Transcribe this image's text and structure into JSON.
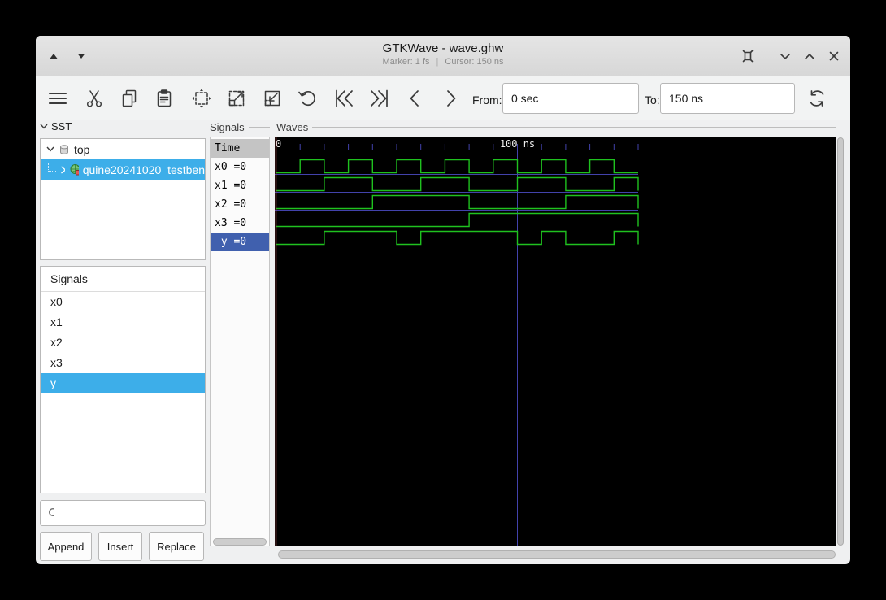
{
  "titlebar": {
    "title": "GTKWave - wave.ghw",
    "marker_status": "Marker: 1 fs",
    "separator": "|",
    "cursor_status": "Cursor: 150 ns"
  },
  "toolbar": {
    "from_label": "From:",
    "from_value": "0 sec",
    "to_label": "To:",
    "to_value": "150 ns"
  },
  "sst": {
    "header": "SST",
    "items": [
      {
        "label": "top",
        "expanded": true
      },
      {
        "label": "quine20241020_testben",
        "selected": true
      }
    ]
  },
  "signal_browser": {
    "header": "Signals",
    "items": [
      "x0",
      "x1",
      "x2",
      "x3",
      "y"
    ],
    "selected": "y",
    "search_placeholder": "",
    "buttons": {
      "append": "Append",
      "insert": "Insert",
      "replace": "Replace"
    }
  },
  "signal_values": {
    "frame_label": "Signals",
    "rows": [
      {
        "text": "Time",
        "header": true
      },
      {
        "text": "x0 =0"
      },
      {
        "text": "x1 =0"
      },
      {
        "text": "x2 =0"
      },
      {
        "text": "x3 =0"
      },
      {
        "text": " y =0",
        "selected": true
      }
    ]
  },
  "waves": {
    "frame_label": "Waves",
    "chart_data": {
      "type": "digital-waveform",
      "time_unit": "ns",
      "t_start": 0,
      "t_end": 150,
      "step": 10,
      "minor_tick_every": 10,
      "major_line_at": 100,
      "timeline_labels": [
        {
          "t": 0,
          "text": "0"
        },
        {
          "t": 100,
          "text": "100 ns"
        }
      ],
      "marker_time": "1 fs",
      "cursor_time": "150 ns",
      "signals": [
        {
          "name": "x0",
          "values": [
            0,
            1,
            0,
            1,
            0,
            1,
            0,
            1,
            0,
            1,
            0,
            1,
            0,
            1,
            0
          ]
        },
        {
          "name": "x1",
          "values": [
            0,
            0,
            1,
            1,
            0,
            0,
            1,
            1,
            0,
            0,
            1,
            1,
            0,
            0,
            1
          ]
        },
        {
          "name": "x2",
          "values": [
            0,
            0,
            0,
            0,
            1,
            1,
            1,
            1,
            0,
            0,
            0,
            0,
            1,
            1,
            1
          ]
        },
        {
          "name": "x3",
          "values": [
            0,
            0,
            0,
            0,
            0,
            0,
            0,
            0,
            1,
            1,
            1,
            1,
            1,
            1,
            1
          ]
        },
        {
          "name": "y",
          "values": [
            0,
            0,
            1,
            1,
            1,
            0,
            1,
            1,
            1,
            1,
            0,
            1,
            0,
            0,
            1
          ]
        }
      ]
    }
  },
  "colors": {
    "selection_blue": "#3daee9",
    "selected_trace_bg": "#4060ae",
    "wave_background": "#000000",
    "wave_trace_green": "#1fc11f",
    "wave_grid_blue": "#4242ac",
    "marker_red": "#c25252",
    "wave_text": "#efefef"
  }
}
